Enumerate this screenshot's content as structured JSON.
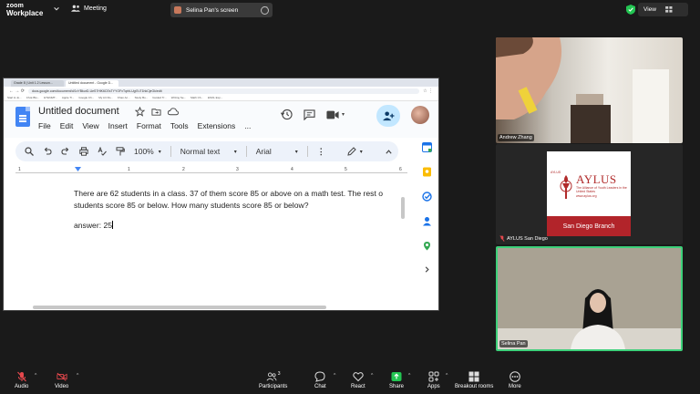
{
  "topbar": {
    "brand_line1": "zoom",
    "brand_line2": "Workplace",
    "meeting_label": "Meeting",
    "share_label": "Selina Pan's screen",
    "view_label": "View",
    "colors": {
      "bg": "#1a1a1a",
      "secure": "#23c552"
    }
  },
  "shared_screen": {
    "browser": {
      "tabs": [
        "Grade 8 | Unit 1.2 Lesson...",
        "Untitled document - Google D..."
      ],
      "url": "docs.google.com/document/d/1xYBkurD-UeS7HlK6CEsTYYOFxTqrhLUgt7uT1hkCjeGk/edit",
      "bookmarks": [
        "Start & Jo...",
        "Ch-E Blo...",
        "ETHNMT...",
        "Apple Tr...",
        "Google Ch...",
        "My Art Ro...",
        "Khan Ac...",
        "Study Bu...",
        "Guided Tr...",
        "Writing Se...",
        "Math Ch...",
        "ESOL Exp..."
      ]
    },
    "docs": {
      "title": "Untitled document",
      "menu": [
        "File",
        "Edit",
        "View",
        "Insert",
        "Format",
        "Tools",
        "Extensions",
        "..."
      ],
      "toolbar": {
        "zoom": "100%",
        "style": "Normal text",
        "font": "Arial"
      },
      "ruler_ticks": [
        "1",
        "1",
        "2",
        "3",
        "4",
        "5",
        "6"
      ],
      "body_line1": "There are 62 students in a class. 37 of them score 85 or above on a math test. The rest o",
      "body_line2": "students score 85 or below. How many students score 85 or below?",
      "answer": "answer: 25"
    }
  },
  "participants": {
    "andrew": {
      "name": "Andrew Zhang"
    },
    "aylus": {
      "name": "AYLUS San Diego",
      "card_tag": "AYLUS",
      "card_title": "AYLUS",
      "card_sub": "The Alliance of Youth Leaders in the United States",
      "card_url": "www.aylus.org",
      "card_branch": "San Diego Branch"
    },
    "selina": {
      "name": "Selina Pan"
    }
  },
  "bottombar": {
    "audio": "Audio",
    "video": "Video",
    "participants": "Participants",
    "participants_count": "3",
    "chat": "Chat",
    "react": "React",
    "share": "Share",
    "apps": "Apps",
    "breakout": "Breakout rooms",
    "more": "More",
    "colors": {
      "muted": "#e5484d",
      "share": "#23c552"
    }
  }
}
